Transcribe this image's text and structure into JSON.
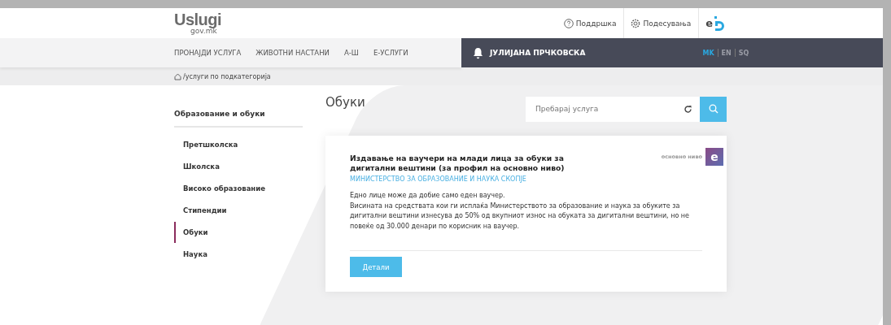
{
  "logo": {
    "name": "Uslugi",
    "domain": "gov.mk"
  },
  "top_links": [
    {
      "kind": "help",
      "label": "Поддршка"
    },
    {
      "kind": "settings",
      "label": "Подесувања"
    }
  ],
  "eid_logo": {
    "letter": "e"
  },
  "nav": [
    {
      "label": "ПРОНАЈДИ УСЛУГА"
    },
    {
      "label": "ЖИВОТНИ НАСТАНИ"
    },
    {
      "label": "А-Ш"
    },
    {
      "label": "Е-УСЛУГИ"
    }
  ],
  "user": {
    "name": "ЈУЛИЈАНА ПРЧКОВСКА"
  },
  "languages": [
    {
      "label": "MK",
      "selected": true
    },
    {
      "label": "EN",
      "selected": false
    },
    {
      "label": "SQ",
      "selected": false
    }
  ],
  "breadcrumb": "/услуги по подкатегорија",
  "sidebar": {
    "title": "Образование и обуки",
    "items": [
      {
        "label": "Претшколска",
        "selected": false
      },
      {
        "label": "Школска",
        "selected": false
      },
      {
        "label": "Високо образование",
        "selected": false
      },
      {
        "label": "Стипендии",
        "selected": false
      },
      {
        "label": "Обуки",
        "selected": true
      },
      {
        "label": "Наука",
        "selected": false
      }
    ]
  },
  "page_title": "Обуки",
  "search": {
    "placeholder": "Пребарај услуга"
  },
  "services": [
    {
      "title": "Издавање на ваучери на млади лица за обуки за дигитални вештини (за профил на основно ниво)",
      "institution": "МИНИСТЕРСТВО ЗА ОБРАЗОВАНИЕ И НАУКА СКОПЈЕ",
      "level": "основно ниво",
      "badge": "e",
      "description": [
        "Едно лице може да добие само еден ваучер.",
        "Висината на средствата кои ги исплаќа Министерството за образование и наука за обуките за дигитални вештини изнесува до 50% од вкупниот износ на обуката за дигитални вештини, но не повеќе од 30.000 денари по корисник на ваучер."
      ],
      "button": "Детали"
    }
  ]
}
